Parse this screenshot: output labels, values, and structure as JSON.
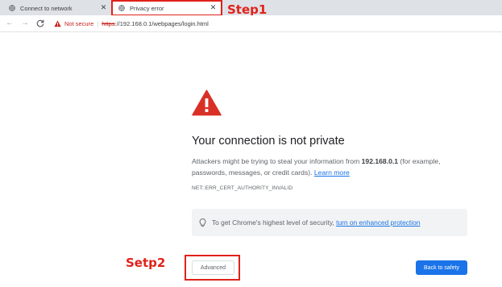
{
  "tabs": [
    {
      "title": "Connect to network",
      "icon": "globe-icon",
      "close": "✕"
    },
    {
      "title": "Privacy error",
      "icon": "globe-icon",
      "close": "✕"
    }
  ],
  "toolbar": {
    "back": "←",
    "forward": "→",
    "reload": "C",
    "security_label": "Not secure",
    "separator": "|",
    "url_scheme": "https",
    "url_rest": "://192.168.0.1/webpages/login.html"
  },
  "annotations": {
    "step1": "Step1",
    "step2": "Setp2",
    "color": "#e0221a"
  },
  "interstitial": {
    "heading": "Your connection is not private",
    "body_prefix": "Attackers might be trying to steal your information from ",
    "host": "192.168.0.1",
    "body_suffix": " (for example, passwords, messages, or credit cards). ",
    "learn_more": "Learn more",
    "error_code": "NET::ERR_CERT_AUTHORITY_INVALID",
    "enhanced_text": "To get Chrome's highest level of security, ",
    "enhanced_link": "turn on enhanced protection",
    "advanced_button": "Advanced",
    "safety_button": "Back to safety"
  },
  "colors": {
    "warning_red": "#d93025",
    "link_blue": "#1a73e8",
    "button_blue": "#1a73e8"
  }
}
